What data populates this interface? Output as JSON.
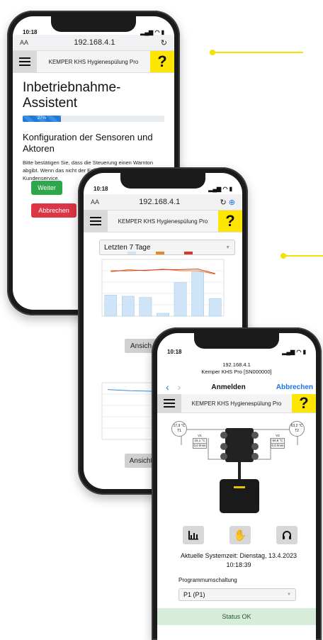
{
  "phone1": {
    "time": "10:18",
    "url": "192.168.4.1",
    "text_size": "AA",
    "app_title": "KEMPER KHS Hygienespülung Pro",
    "help": "?",
    "heading": "Inbetriebnahme-Assistent",
    "progress_label": "27%",
    "progress_value": 0.27,
    "section_title": "Konfiguration der Sensoren und Aktoren",
    "body": "Bitte bestätigen Sie, dass die Steuerung einen Warnton abgibt. Wenn das nicht der Fall ist, wenden Sie sich an den Kundenservice.",
    "btn_next": "Weiter",
    "btn_cancel": "Abbrechen"
  },
  "phone2": {
    "time": "10:18",
    "url": "192.168.4.1",
    "text_size": "AA",
    "app_title": "KEMPER KHS Hygienespülung Pro",
    "help": "?",
    "select_value": "Letzten 7 Tage",
    "btn_view": "Ansich",
    "btn_view2": "Ansicht"
  },
  "phone3": {
    "time": "10:18",
    "url_line1": "192.168.4.1",
    "url_line2": "Kemper KHS Pro [SN000000]",
    "nav_title": "Anmelden",
    "nav_cancel": "Abbrechen",
    "app_title": "KEMPER KHS Hygienespülung Pro",
    "help": "?",
    "sensor_left": {
      "temp": "17,9 °C",
      "id": "T1"
    },
    "sensor_right": {
      "temp": "63,2 °C",
      "id": "T2"
    },
    "valve_left": {
      "id": "V1",
      "temp": "15,1 °C",
      "flow": "0,0 l/min"
    },
    "valve_right": {
      "id": "V2",
      "temp": "60,8 °C",
      "flow": "0,0 l/min"
    },
    "system_time": "Aktuelle Systemzeit: Dienstag, 13.4.2023 10:18:39",
    "program_label": "Programmumschaltung",
    "program_value": "P1 (P1)",
    "status": "Status OK"
  },
  "chart_data": [
    {
      "type": "bar",
      "series": [
        {
          "name": "",
          "values": [
            0.37,
            0.35,
            0.33,
            0.05,
            0.59,
            0.78,
            0.31
          ]
        },
        {
          "name": "",
          "values": [
            0.78,
            0.82,
            0.8,
            0.83,
            0.8,
            0.8,
            0.74
          ]
        },
        {
          "name": "",
          "values": [
            0.8,
            0.8,
            0.81,
            0.82,
            0.82,
            0.83,
            0.75
          ]
        }
      ],
      "colors": [
        "#cfe4f7",
        "#e08a2c",
        "#d23a2a"
      ]
    },
    {
      "type": "line",
      "series": [
        {
          "name": "",
          "values": [
            0.88,
            0.86,
            0.85,
            0.85
          ]
        }
      ],
      "colors": [
        "#3a8fd6"
      ]
    }
  ],
  "colors": {
    "help_yellow": "#ffe600",
    "success": "#2ea64a",
    "danger": "#dc3545",
    "link": "#1a73e8",
    "status_ok": "#d7ecd9"
  }
}
